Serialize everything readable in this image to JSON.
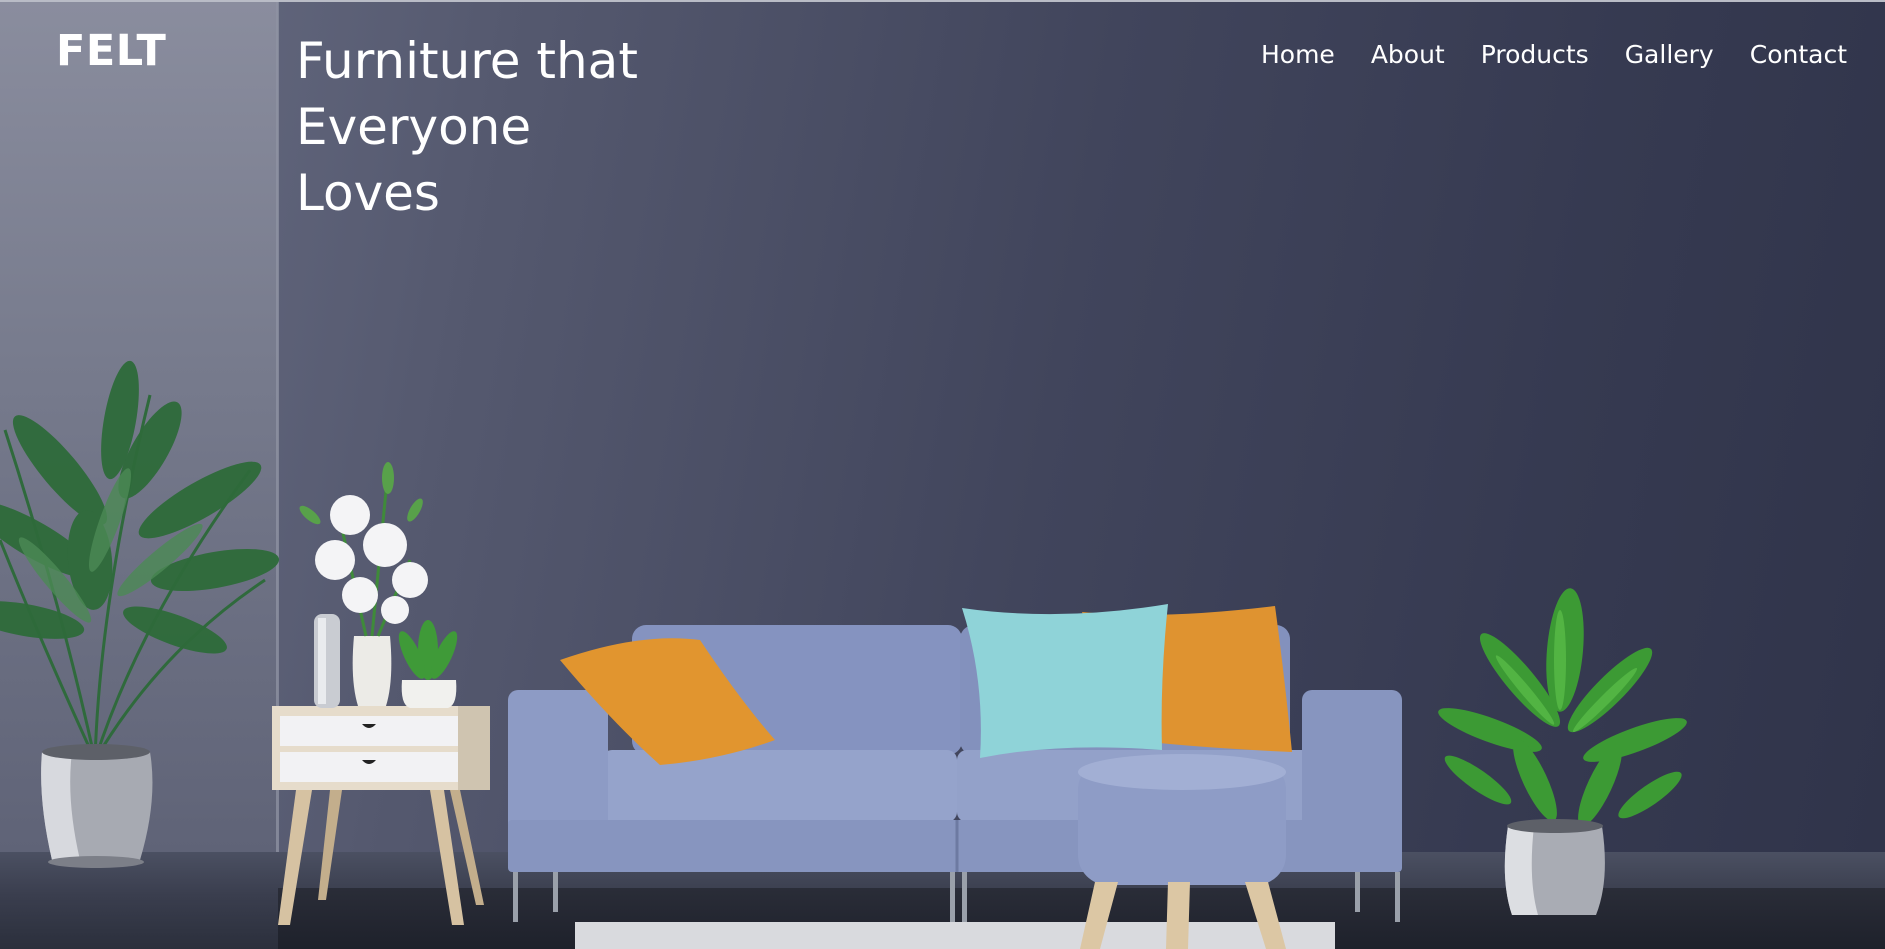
{
  "brand": {
    "logo_text": "FELT"
  },
  "hero": {
    "headline_lines": [
      "Furniture that",
      "Everyone",
      "Loves"
    ]
  },
  "nav": {
    "items": [
      {
        "label": "Home"
      },
      {
        "label": "About"
      },
      {
        "label": "Products"
      },
      {
        "label": "Gallery"
      },
      {
        "label": "Contact"
      }
    ]
  },
  "colors": {
    "wall": "#3a3e55",
    "text": "#ffffff",
    "sofa": "#8e9cc6",
    "pillow_orange": "#e0962f",
    "pillow_teal": "#8fd3d8",
    "plant_green": "#3c9a34"
  }
}
